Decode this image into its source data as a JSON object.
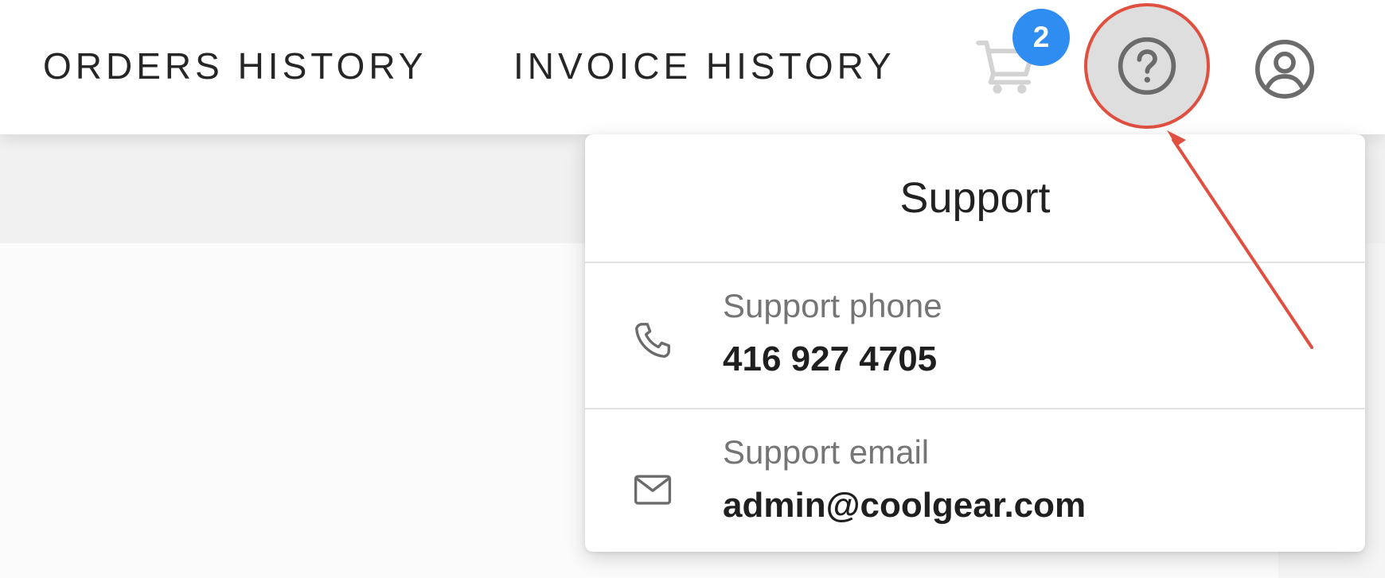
{
  "header": {
    "nav": [
      {
        "label": "ORDERS HISTORY"
      },
      {
        "label": "INVOICE HISTORY"
      }
    ],
    "cart": {
      "icon": "cart-icon",
      "badge_count": "2"
    },
    "help": {
      "icon": "help-circle-icon"
    },
    "account": {
      "icon": "account-circle-icon"
    }
  },
  "support_popover": {
    "title": "Support",
    "phone": {
      "icon": "phone-icon",
      "label": "Support phone",
      "value": "416 927 4705"
    },
    "email": {
      "icon": "mail-icon",
      "label": "Support email",
      "value": "admin@coolgear.com"
    }
  },
  "annotation": {
    "color": "#e05040"
  },
  "colors": {
    "badge": "#2f8cf0",
    "help_button_bg": "#dedede",
    "icon": "#6b6b6b"
  }
}
